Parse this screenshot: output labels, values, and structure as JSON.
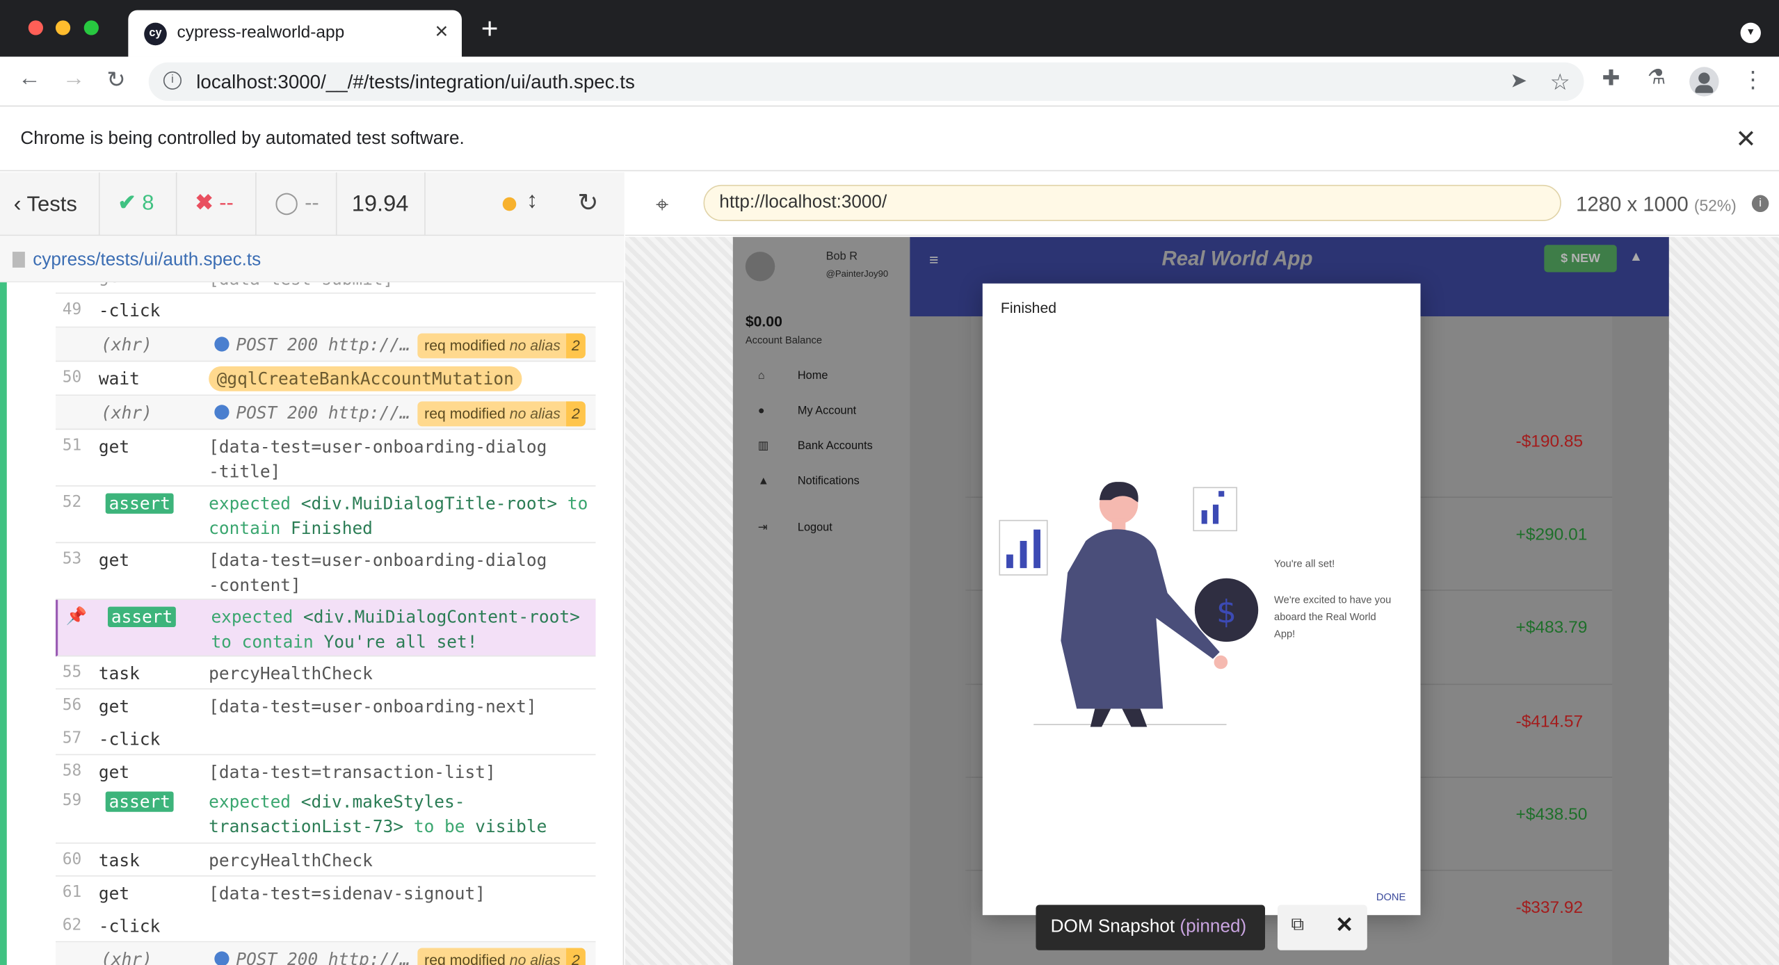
{
  "browser": {
    "tab_title": "cypress-realworld-app",
    "tab_favicon": "cy",
    "url": "localhost:3000/__/#/tests/integration/ui/auth.spec.ts",
    "infobar_message": "Chrome is being controlled by automated test software."
  },
  "reporter": {
    "back_label": "Tests",
    "passed_count": "8",
    "failed_count": "--",
    "pending_count": "--",
    "duration": "19.94",
    "spec_file": "cypress/tests/ui/auth.spec.ts"
  },
  "commands": [
    {
      "num": "49",
      "cmd": "-click",
      "msg": ""
    },
    {
      "num": "",
      "cmd": "(xhr)",
      "msg": "POST 200 http://…",
      "badge": "req modified",
      "alias": "no alias",
      "count": "2"
    },
    {
      "num": "50",
      "cmd": "wait",
      "msg": "@gqlCreateBankAccountMutation"
    },
    {
      "num": "",
      "cmd": "(xhr)",
      "msg": "POST 200 http://…",
      "badge": "req modified",
      "alias": "no alias",
      "count": "2"
    },
    {
      "num": "51",
      "cmd": "get",
      "msg": "[data-test=user-onboarding-dialog-title]"
    },
    {
      "num": "52",
      "cmd": "-assert",
      "msg_parts": [
        "expected",
        "<div.MuiDialogTitle-root>",
        "to contain",
        "Finished"
      ]
    },
    {
      "num": "53",
      "cmd": "get",
      "msg": "[data-test=user-onboarding-dialog-content]"
    },
    {
      "num": "",
      "cmd": "-assert",
      "msg_parts": [
        "expected",
        "<div.MuiDialogContent-root>",
        "to contain",
        "You're all set!"
      ]
    },
    {
      "num": "55",
      "cmd": "task",
      "msg": "percyHealthCheck"
    },
    {
      "num": "56",
      "cmd": "get",
      "msg": "[data-test=user-onboarding-next]"
    },
    {
      "num": "57",
      "cmd": "-click",
      "msg": ""
    },
    {
      "num": "58",
      "cmd": "get",
      "msg": "[data-test=transaction-list]"
    },
    {
      "num": "59",
      "cmd": "-assert",
      "msg_parts": [
        "expected",
        "<div.makeStyles-transactionList-73>",
        "to be",
        "visible"
      ]
    },
    {
      "num": "60",
      "cmd": "task",
      "msg": "percyHealthCheck"
    },
    {
      "num": "61",
      "cmd": "get",
      "msg": "[data-test=sidenav-signout]"
    },
    {
      "num": "62",
      "cmd": "-click",
      "msg": ""
    },
    {
      "num": "",
      "cmd": "(xhr)",
      "msg": "POST 200 http://…",
      "badge": "req modified",
      "alias": "no alias",
      "count": "2"
    }
  ],
  "aut": {
    "url": "http://localhost:3000/",
    "viewport": "1280 x 1000",
    "scale": "(52%)"
  },
  "app": {
    "user_name": "Bob R",
    "user_handle": "@PainterJoy90",
    "balance": "$0.00",
    "balance_label": "Account Balance",
    "nav": [
      "Home",
      "My Account",
      "Bank Accounts",
      "Notifications",
      "Logout"
    ],
    "title": "Real World App",
    "new_button": "$ NEW",
    "amounts": [
      "-$190.85",
      "+$290.01",
      "+$483.79",
      "-$414.57",
      "+$438.50",
      "-$337.92"
    ]
  },
  "dialog": {
    "title": "Finished",
    "line1": "You're all set!",
    "line2": "We're excited to have you aboard the Real World App!",
    "done": "DONE"
  },
  "snapshot": {
    "label": "DOM Snapshot",
    "state": "(pinned)"
  },
  "colors": {
    "pass": "#40c282",
    "fail": "#e94f5f",
    "assert": "#3db47b",
    "app_bar": "#2c3473",
    "illustration": "#4a4e7a"
  }
}
